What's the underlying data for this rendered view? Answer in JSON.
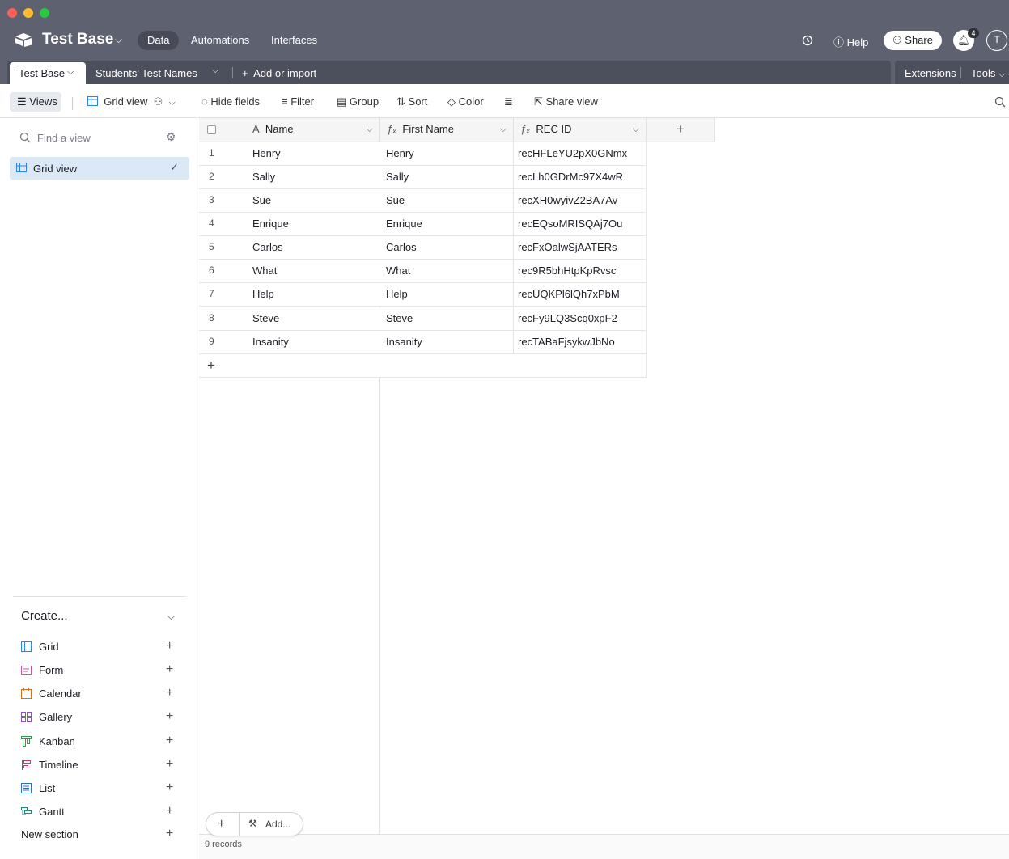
{
  "header": {
    "base_title": "Test Base",
    "nav": [
      {
        "label": "Data",
        "active": true
      },
      {
        "label": "Automations",
        "active": false
      },
      {
        "label": "Interfaces",
        "active": false
      }
    ],
    "help_label": "Help",
    "share_label": "Share",
    "notification_count": "4",
    "avatar_initial": "T"
  },
  "tabs": {
    "active": "Test Base",
    "other": "Students' Test Names",
    "add_label": "Add or import",
    "extensions_label": "Extensions",
    "tools_label": "Tools"
  },
  "toolbar": {
    "views_label": "Views",
    "view_name": "Grid view",
    "hide_fields": "Hide fields",
    "filter": "Filter",
    "group": "Group",
    "sort": "Sort",
    "color": "Color",
    "share_view": "Share view"
  },
  "sidebar": {
    "find_placeholder": "Find a view",
    "views": [
      {
        "label": "Grid view",
        "selected": true
      }
    ],
    "create_title": "Create...",
    "create_items": [
      {
        "label": "Grid",
        "icon": "grid-icon",
        "color": "#2d7ff9"
      },
      {
        "label": "Form",
        "icon": "form-icon",
        "color": "#d84fb0"
      },
      {
        "label": "Calendar",
        "icon": "calendar-icon",
        "color": "#e26c1b"
      },
      {
        "label": "Gallery",
        "icon": "gallery-icon",
        "color": "#8e4fd8"
      },
      {
        "label": "Kanban",
        "icon": "kanban-icon",
        "color": "#2e9d4a"
      },
      {
        "label": "Timeline",
        "icon": "timeline-icon",
        "color": "#d6336c"
      },
      {
        "label": "List",
        "icon": "list-icon",
        "color": "#2d6fd9"
      },
      {
        "label": "Gantt",
        "icon": "gantt-icon",
        "color": "#1f8a7a"
      }
    ],
    "new_section": "New section"
  },
  "grid": {
    "columns": [
      {
        "label": "Name",
        "icon": "text-field-icon"
      },
      {
        "label": "First Name",
        "icon": "formula-icon"
      },
      {
        "label": "REC ID",
        "icon": "formula-icon"
      }
    ],
    "rows": [
      {
        "n": "1",
        "name": "Henry",
        "first": "Henry",
        "rec": "recHFLeYU2pX0GNmx"
      },
      {
        "n": "2",
        "name": "Sally",
        "first": "Sally",
        "rec": "recLh0GDrMc97X4wR"
      },
      {
        "n": "3",
        "name": "Sue",
        "first": "Sue",
        "rec": "recXH0wyivZ2BA7Av"
      },
      {
        "n": "4",
        "name": "Enrique",
        "first": "Enrique",
        "rec": "recEQsoMRISQAj7Ou"
      },
      {
        "n": "5",
        "name": "Carlos",
        "first": "Carlos",
        "rec": "recFxOalwSjAATERs"
      },
      {
        "n": "6",
        "name": "What",
        "first": "What",
        "rec": "rec9R5bhHtpKpRvsc"
      },
      {
        "n": "7",
        "name": "Help",
        "first": "Help",
        "rec": "recUQKPl6lQh7xPbM"
      },
      {
        "n": "8",
        "name": "Steve",
        "first": "Steve",
        "rec": "recFy9LQ3Scq0xpF2"
      },
      {
        "n": "9",
        "name": "Insanity",
        "first": "Insanity",
        "rec": "recTABaFjsykwJbNo"
      }
    ],
    "record_count": "9 records",
    "add_label": "Add..."
  }
}
